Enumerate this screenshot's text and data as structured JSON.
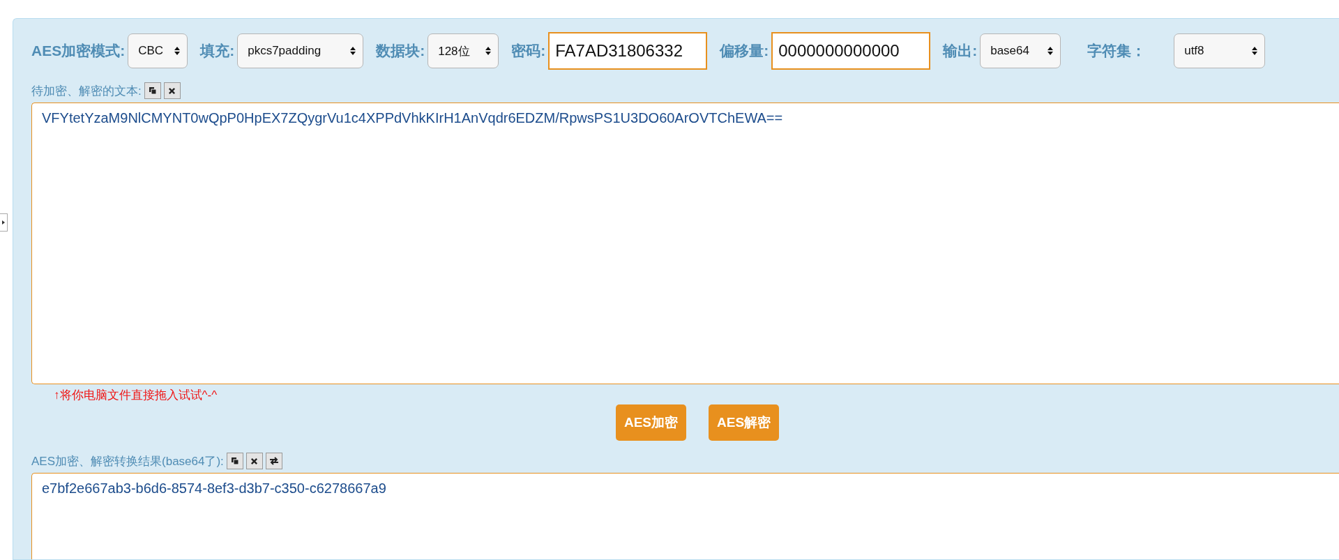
{
  "toolbar": {
    "mode": {
      "label": "AES加密模式:",
      "value": "CBC"
    },
    "padding": {
      "label": "填充:",
      "value": "pkcs7padding"
    },
    "block": {
      "label": "数据块:",
      "value": "128位"
    },
    "password": {
      "label": "密码:",
      "value": "FA7AD31806332"
    },
    "offset": {
      "label": "偏移量:",
      "value": "0000000000000"
    },
    "output": {
      "label": "输出:",
      "value": "base64"
    },
    "charset": {
      "label": "字符集：",
      "value": "utf8"
    }
  },
  "input_section": {
    "label": "待加密、解密的文本:",
    "tools": [
      {
        "kind": "copy"
      },
      {
        "kind": "clear"
      }
    ],
    "text": "VFYtetYzaM9NlCMYNT0wQpP0HpEX7ZQygrVu1c4XPPdVhkKIrH1AnVqdr6EDZM/RpwsPS1U3DO60ArOVTChEWA==",
    "hint": "↑将你电脑文件直接拖入试试^-^"
  },
  "actions": [
    "AES加密",
    "AES解密"
  ],
  "result_section": {
    "label": "AES加密、解密转换结果(base64了):",
    "tools": [
      {
        "kind": "copy"
      },
      {
        "kind": "clear"
      },
      {
        "kind": "swap"
      }
    ],
    "text": "e7bf2e667ab3-b6d6-8574-8ef3-d3b7-c350-c6278667a9"
  }
}
